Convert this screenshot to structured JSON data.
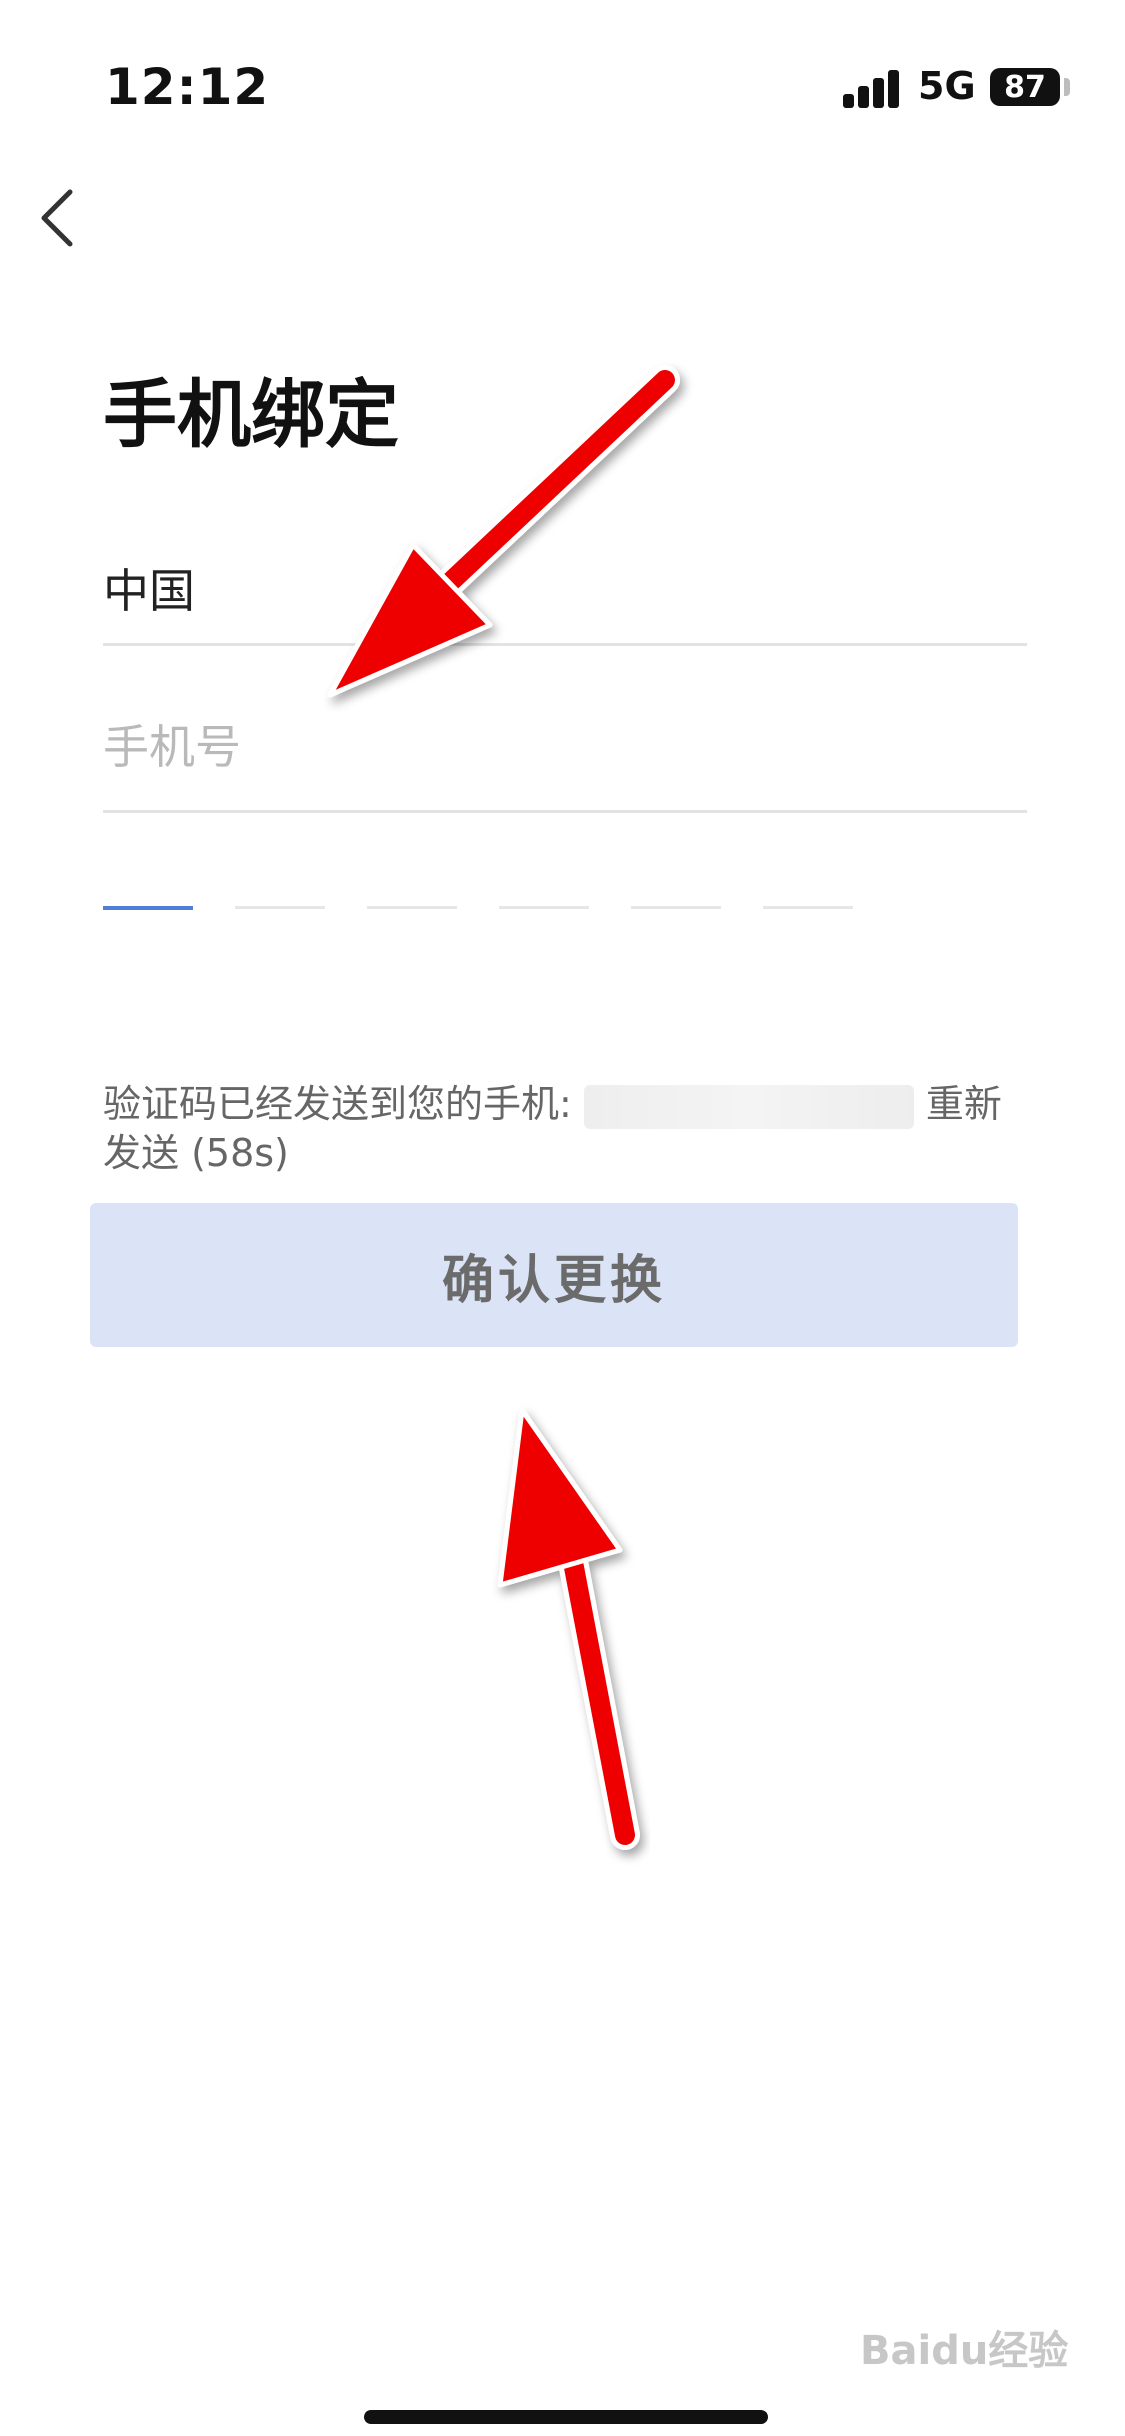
{
  "status_bar": {
    "time": "12:12",
    "network": "5G",
    "battery": "87"
  },
  "header": {
    "title": "手机绑定"
  },
  "form": {
    "country": "中国",
    "phone_placeholder": "手机号",
    "phone_value": "",
    "code_length": 6
  },
  "hint": {
    "prefix": "验证码已经发送到您的手机:",
    "resend": "重新发送 (58s)"
  },
  "buttons": {
    "confirm_label": "确认更换"
  },
  "watermark": "Baidu经验",
  "colors": {
    "accent": "#4f7fd6",
    "button_bg": "#dbe4f6",
    "annotation_arrow": "#ee0000"
  }
}
